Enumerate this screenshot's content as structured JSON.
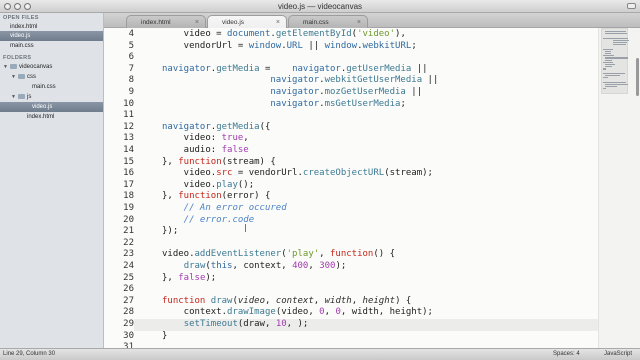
{
  "window": {
    "title": "video.js — videocanvas"
  },
  "sidebar": {
    "open_files_header": "OPEN FILES",
    "open_files": [
      "index.html",
      "video.js",
      "main.css"
    ],
    "folders_header": "FOLDERS",
    "tree": [
      "videocanvas",
      "css",
      "main.css",
      "js",
      "video.js",
      "index.html"
    ]
  },
  "tabs": [
    {
      "label": "index.html",
      "close": "×"
    },
    {
      "label": "video.js",
      "close": "×"
    },
    {
      "label": "main.css",
      "close": "×"
    }
  ],
  "editor": {
    "line_numbers": [
      "4",
      "5",
      "6",
      "7",
      "8",
      "9",
      "10",
      "11",
      "12",
      "13",
      "14",
      "15",
      "16",
      "17",
      "18",
      "19",
      "20",
      "21",
      "22",
      "23",
      "24",
      "25",
      "26",
      "27",
      "28",
      "29",
      "30",
      "31"
    ],
    "lines": [
      [
        [
          "t",
          "    video = "
        ],
        [
          "g",
          "document"
        ],
        [
          "t",
          "."
        ],
        [
          "f",
          "getElementById"
        ],
        [
          "t",
          "("
        ],
        [
          "s",
          "'video'"
        ],
        [
          "t",
          "),"
        ]
      ],
      [
        [
          "t",
          "    vendorUrl = "
        ],
        [
          "g",
          "window"
        ],
        [
          "t",
          "."
        ],
        [
          "g",
          "URL"
        ],
        [
          "t",
          " || "
        ],
        [
          "g",
          "window"
        ],
        [
          "t",
          "."
        ],
        [
          "g",
          "webkitURL"
        ],
        [
          "t",
          ";"
        ]
      ],
      [],
      [
        [
          "g",
          "navigator"
        ],
        [
          "t",
          "."
        ],
        [
          "f",
          "getMedia"
        ],
        [
          "t",
          " =    "
        ],
        [
          "g",
          "navigator"
        ],
        [
          "t",
          "."
        ],
        [
          "f",
          "getUserMedia"
        ],
        [
          "t",
          " ||"
        ]
      ],
      [
        [
          "t",
          "                    "
        ],
        [
          "g",
          "navigator"
        ],
        [
          "t",
          "."
        ],
        [
          "f",
          "webkitGetUserMedia"
        ],
        [
          "t",
          " ||"
        ]
      ],
      [
        [
          "t",
          "                    "
        ],
        [
          "g",
          "navigator"
        ],
        [
          "t",
          "."
        ],
        [
          "f",
          "mozGetUserMedia"
        ],
        [
          "t",
          " ||"
        ]
      ],
      [
        [
          "t",
          "                    "
        ],
        [
          "g",
          "navigator"
        ],
        [
          "t",
          "."
        ],
        [
          "f",
          "msGetUserMedia"
        ],
        [
          "t",
          ";"
        ]
      ],
      [],
      [
        [
          "g",
          "navigator"
        ],
        [
          "t",
          "."
        ],
        [
          "f",
          "getMedia"
        ],
        [
          "t",
          "({"
        ]
      ],
      [
        [
          "t",
          "    video: "
        ],
        [
          "b",
          "true"
        ],
        [
          "t",
          ","
        ]
      ],
      [
        [
          "t",
          "    audio: "
        ],
        [
          "b",
          "false"
        ]
      ],
      [
        [
          "t",
          "}, "
        ],
        [
          "k",
          "function"
        ],
        [
          "t",
          "(stream) {"
        ]
      ],
      [
        [
          "t",
          "    video."
        ],
        [
          "k",
          "src"
        ],
        [
          "t",
          " = vendorUrl."
        ],
        [
          "f",
          "createObjectURL"
        ],
        [
          "t",
          "(stream);"
        ]
      ],
      [
        [
          "t",
          "    video."
        ],
        [
          "f",
          "play"
        ],
        [
          "t",
          "();"
        ]
      ],
      [
        [
          "t",
          "}, "
        ],
        [
          "k",
          "function"
        ],
        [
          "t",
          "(error) {"
        ]
      ],
      [
        [
          "c",
          "    // An error occured"
        ]
      ],
      [
        [
          "c",
          "    // error.code"
        ]
      ],
      [
        [
          "t",
          "});"
        ]
      ],
      [],
      [
        [
          "t",
          "video."
        ],
        [
          "f",
          "addEventListener"
        ],
        [
          "t",
          "("
        ],
        [
          "s",
          "'play'"
        ],
        [
          "t",
          ", "
        ],
        [
          "k",
          "function"
        ],
        [
          "t",
          "() {"
        ]
      ],
      [
        [
          "t",
          "    "
        ],
        [
          "f",
          "draw"
        ],
        [
          "t",
          "("
        ],
        [
          "g",
          "this"
        ],
        [
          "t",
          ", context, "
        ],
        [
          "n",
          "400"
        ],
        [
          "t",
          ", "
        ],
        [
          "n",
          "300"
        ],
        [
          "t",
          ");"
        ]
      ],
      [
        [
          "t",
          "}, "
        ],
        [
          "b",
          "false"
        ],
        [
          "t",
          ");"
        ]
      ],
      [],
      [
        [
          "k",
          "function"
        ],
        [
          "t",
          " "
        ],
        [
          "f",
          "draw"
        ],
        [
          "t",
          "("
        ],
        [
          "p",
          "video"
        ],
        [
          "t",
          ", "
        ],
        [
          "p",
          "context"
        ],
        [
          "t",
          ", "
        ],
        [
          "p",
          "width"
        ],
        [
          "t",
          ", "
        ],
        [
          "p",
          "height"
        ],
        [
          "t",
          ") {"
        ]
      ],
      [
        [
          "t",
          "    context."
        ],
        [
          "f",
          "drawImage"
        ],
        [
          "t",
          "(video, "
        ],
        [
          "n",
          "0"
        ],
        [
          "t",
          ", "
        ],
        [
          "n",
          "0"
        ],
        [
          "t",
          ", width, height);"
        ]
      ],
      [
        [
          "t",
          "    "
        ],
        [
          "f",
          "setTimeout"
        ],
        [
          "t",
          "(draw, "
        ],
        [
          "n",
          "10"
        ],
        [
          "t",
          ", );"
        ]
      ],
      [
        [
          "t",
          "}"
        ]
      ],
      []
    ],
    "current_line_index": 25
  },
  "status": {
    "position": "Line 29, Column 30",
    "spaces": "Spaces: 4",
    "language": "JavaScript"
  }
}
